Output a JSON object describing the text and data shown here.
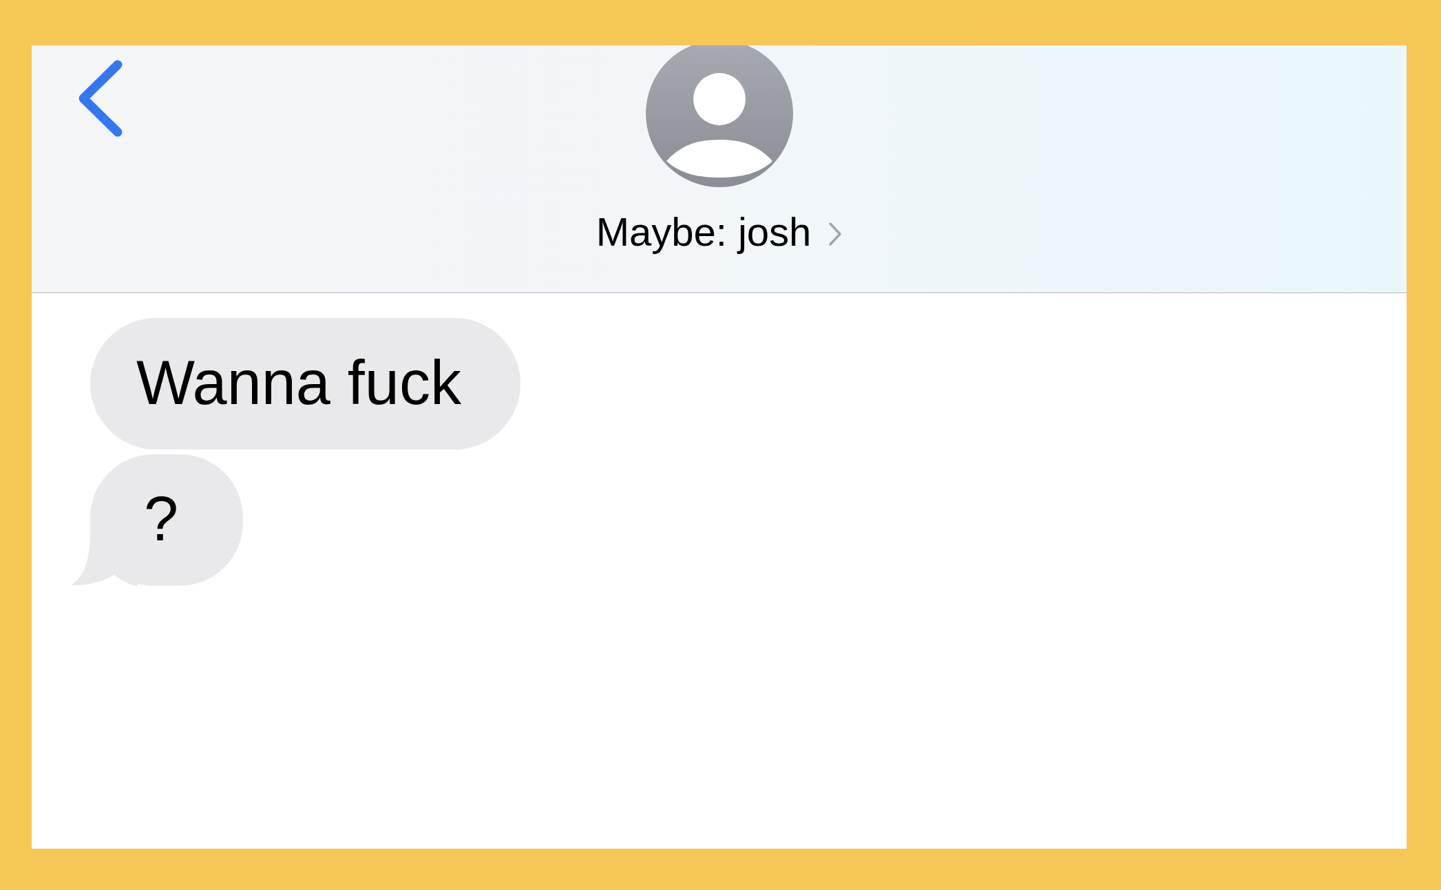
{
  "conversation_header": {
    "contact_name": "Maybe: josh"
  },
  "messages": [
    {
      "text": "Wanna fuck",
      "tail": false
    },
    {
      "text": "?",
      "tail": true
    }
  ]
}
